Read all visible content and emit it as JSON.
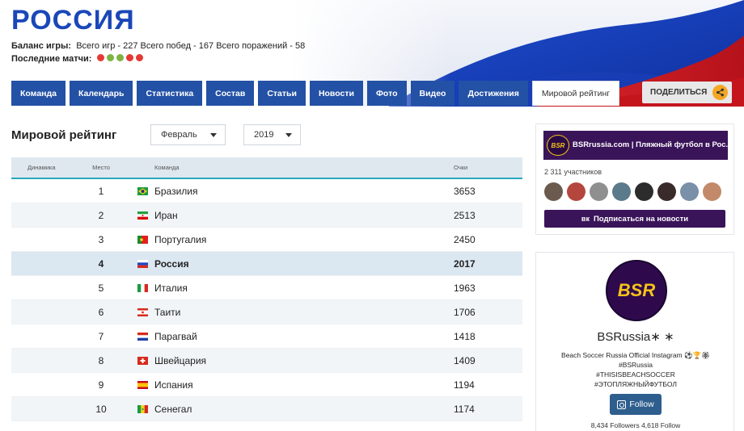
{
  "header": {
    "title": "РОССИЯ",
    "balance_label": "Баланс игры:",
    "balance_text": "Всего игр - 227 Всего побед - 167 Всего поражений - 58",
    "last_matches_label": "Последние матчи:",
    "last_matches": [
      {
        "result": "loss",
        "color": "#e53935"
      },
      {
        "result": "win",
        "color": "#7cb342"
      },
      {
        "result": "win",
        "color": "#7cb342"
      },
      {
        "result": "loss",
        "color": "#e53935"
      },
      {
        "result": "loss",
        "color": "#e53935"
      }
    ]
  },
  "tabs": [
    {
      "label": "Команда"
    },
    {
      "label": "Календарь"
    },
    {
      "label": "Статистика"
    },
    {
      "label": "Состав"
    },
    {
      "label": "Статьи"
    },
    {
      "label": "Новости"
    },
    {
      "label": "Фото"
    },
    {
      "label": "Видео"
    },
    {
      "label": "Достижения"
    },
    {
      "label": "Мировой рейтинг",
      "active": true
    }
  ],
  "share": {
    "label": "ПОДЕЛИТЬСЯ",
    "icon": "share-icon"
  },
  "rating": {
    "title": "Мировой рейтинг",
    "month": "Февраль",
    "year": "2019",
    "columns": {
      "dynamics": "Динамика",
      "place": "Место",
      "team": "Команда",
      "points": "Очки"
    },
    "rows": [
      {
        "place": "1",
        "team": "Бразилия",
        "points": "3653",
        "flag": "brazil"
      },
      {
        "place": "2",
        "team": "Иран",
        "points": "2513",
        "flag": "iran"
      },
      {
        "place": "3",
        "team": "Португалия",
        "points": "2450",
        "flag": "portugal"
      },
      {
        "place": "4",
        "team": "Россия",
        "points": "2017",
        "flag": "russia",
        "highlight": true
      },
      {
        "place": "5",
        "team": "Италия",
        "points": "1963",
        "flag": "italy"
      },
      {
        "place": "6",
        "team": "Таити",
        "points": "1706",
        "flag": "tahiti"
      },
      {
        "place": "7",
        "team": "Парагвай",
        "points": "1418",
        "flag": "paraguay"
      },
      {
        "place": "8",
        "team": "Швейцария",
        "points": "1409",
        "flag": "switzerland"
      },
      {
        "place": "9",
        "team": "Испания",
        "points": "1194",
        "flag": "spain"
      },
      {
        "place": "10",
        "team": "Сенегал",
        "points": "1174",
        "flag": "senegal"
      }
    ]
  },
  "vk_widget": {
    "banner_title": "BSRrussia.com | Пляжный футбол в Рос...",
    "logo_text": "BSR",
    "members": "2 311 участников",
    "subscribe_label": "Подписаться на новости",
    "subscribe_icon": "vk-icon"
  },
  "ig_widget": {
    "logo_text": "BSR",
    "name": "BSRussia∗ ∗",
    "bio_lines": [
      "Beach Soccer Russia Official Instagram ⚽🏆🏵",
      "#BSRussia",
      "#THISISBEACHSOCCER",
      "#ЭТОПЛЯЖНЫЙФУТБОЛ"
    ],
    "follow_label": "Follow",
    "stats": "8,434 Followers 4,618 Follow"
  }
}
